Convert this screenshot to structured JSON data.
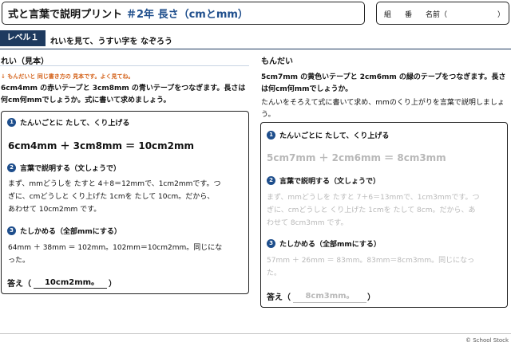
{
  "header": {
    "title": "式と言葉で説明プリント",
    "subtitle": "＃2年 長さ（cmとmm）",
    "name_fields": {
      "kumi": "組",
      "ban": "番",
      "namae": "名前（",
      "close": "）"
    }
  },
  "level": {
    "badge": "レベル１",
    "instruction": "れいを見て、うすい字を なぞろう"
  },
  "example": {
    "heading": "れい（見本）",
    "note": "↓ もんだいと 同じ書き方の 見本です。よく見てね。",
    "problem": [
      "6cm4mm の赤いテープと 3cm8mm の青いテープをつなぎます。長さは",
      "何cm何mmでしょうか。式に書いて求めましょう。"
    ],
    "step1": {
      "num": "1",
      "label": "たんいごとに たして、くり上げる"
    },
    "equation": "6cm4mm ＋ 3cm8mm ＝ 10cm2mm",
    "step2": {
      "num": "2",
      "label": "言葉で説明する（文しょうで）"
    },
    "explanation": [
      "まず、mmどうしを たすと 4＋8＝12mmで、1cm2mmです。つ",
      "ぎに、cmどうしと くり上げた 1cmを たして 10cm。だから、",
      "あわせて 10cm2mm です。"
    ],
    "step3": {
      "num": "3",
      "label": "たしかめる（全部mmにする）"
    },
    "check": [
      "64mm ＋ 38mm ＝ 102mm。102mm＝10cm2mm。同じにな",
      "った。"
    ],
    "answer_label": "答え（",
    "answer_value": "10cm2mm。",
    "answer_close": "）"
  },
  "problem": {
    "heading": "もんだい",
    "problem": [
      "5cm7mm の黄色いテープと 2cm6mm の緑のテープをつなぎます。長さ",
      "は何cm何mmでしょうか。"
    ],
    "instruction": [
      "たんいをそろえて式に書いて求め、mmのくり上がりを言葉で説明しましょ",
      "う。"
    ],
    "step1": {
      "num": "1",
      "label": "たんいごとに たして、くり上げる"
    },
    "equation": "5cm7mm ＋ 2cm6mm ＝ 8cm3mm",
    "step2": {
      "num": "2",
      "label": "言葉で説明する（文しょうで）"
    },
    "explanation": [
      "まず、mmどうしを たすと 7＋6＝13mmで、1cm3mmです。つ",
      "ぎに、cmどうしと くり上げた 1cmを たして 8cm。だから、あ",
      "わせて 8cm3mm です。"
    ],
    "step3": {
      "num": "3",
      "label": "たしかめる（全部mmにする）"
    },
    "check": [
      "57mm ＋ 26mm ＝ 83mm。83mm＝8cm3mm。同じになっ",
      "た。"
    ],
    "answer_label": "答え（",
    "answer_value": "8cm3mm。",
    "answer_close": "）"
  },
  "footer": "© School Stock",
  "colors": {
    "navy": "#1e3a5f",
    "blue": "#1e4e8c",
    "orange": "#d4621a",
    "trace_gray": "#b8b8b8"
  }
}
